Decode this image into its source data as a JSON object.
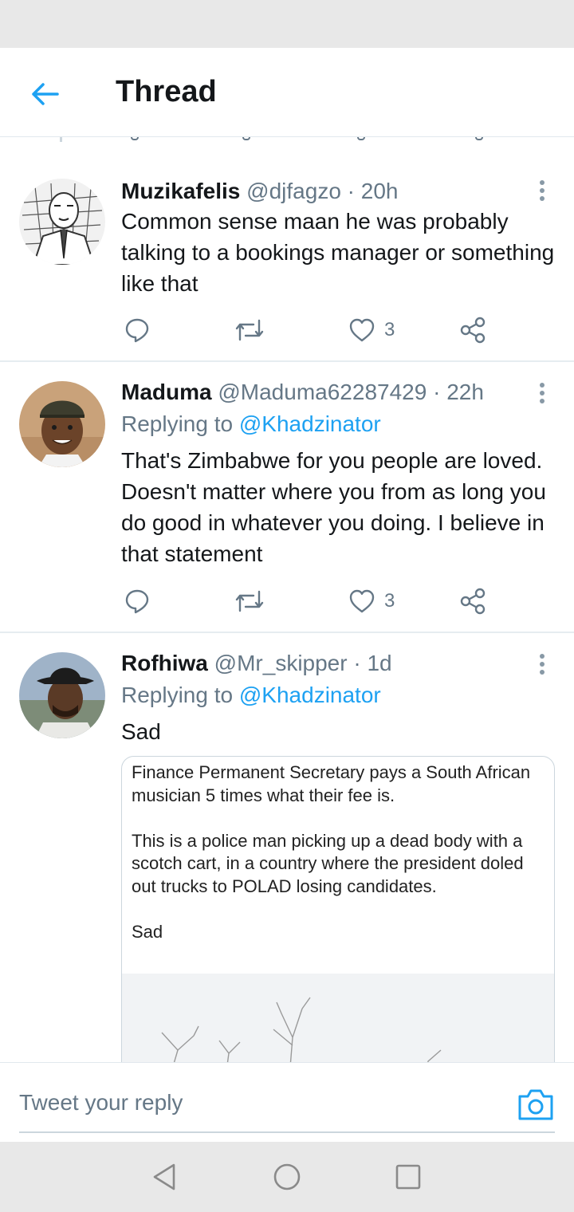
{
  "header": {
    "title": "Thread"
  },
  "tweets": [
    {
      "name": "Muzikafelis",
      "handle": "@djfagzo",
      "time": "· 20h",
      "text": "Common sense maan he was probably talking to a bookings manager or something like that",
      "likes": "3"
    },
    {
      "name": "Maduma",
      "handle": "@Maduma62287429",
      "time": "· 22h",
      "reply_prefix": "Replying to",
      "reply_mention": "@Khadzinator",
      "text": "That's Zimbabwe for you people are loved. Doesn't matter where you from as long you do good in whatever you doing. I believe in that statement",
      "likes": "3"
    },
    {
      "name": "Rofhiwa",
      "handle": "@Mr_skipper",
      "time": "· 1d",
      "reply_prefix": "Replying to",
      "reply_mention": "@Khadzinator",
      "text": "Sad",
      "embed": {
        "line1": "Finance Permanent Secretary pays a South African musician 5 times what their fee is.",
        "line2": "This is a police man picking up a dead body with a scotch cart, in a country where the president doled out trucks to POLAD losing candidates.",
        "line3": "Sad"
      }
    }
  ],
  "reply_bar": {
    "placeholder": "Tweet your reply"
  },
  "icons": {
    "back": "arrow-left-icon",
    "reply": "comment-icon",
    "retweet": "retweet-icon",
    "like": "heart-icon",
    "share": "share-icon",
    "more": "more-vertical-icon",
    "camera": "camera-icon",
    "nav_back": "triangle-back-icon",
    "nav_home": "circle-home-icon",
    "nav_recents": "square-recents-icon"
  },
  "colors": {
    "accent": "#1da1f2",
    "secondary_text": "#657786",
    "primary_text": "#14171a",
    "divider": "#e6ecf0"
  }
}
